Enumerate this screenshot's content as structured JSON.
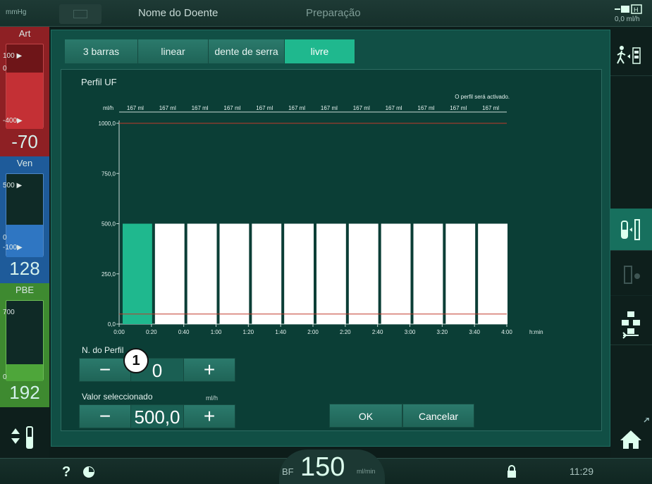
{
  "topbar": {
    "pressure_unit": "mmHg",
    "patient_name": "Nome do Doente",
    "phase": "Preparação",
    "uf_rate": "0,0  ml/h"
  },
  "pressures": {
    "art": {
      "label": "Art",
      "top_tick": "100 ▶",
      "zero_tick": "0",
      "bottom_tick": "-400▶",
      "value": "-70",
      "color": "#b52a2f"
    },
    "ven": {
      "label": "Ven",
      "top_tick": "500 ▶",
      "zero_tick": "0",
      "bottom_tick": "-100▶",
      "value": "128",
      "color": "#2a6bb0"
    },
    "pbe": {
      "label": "PBE",
      "top_tick": "700",
      "zero_tick": "0",
      "value": "192",
      "color": "#4ea63a"
    }
  },
  "tabs": [
    {
      "label": "3 barras",
      "active": false
    },
    {
      "label": "linear",
      "active": false
    },
    {
      "label": "dente de serra",
      "active": false
    },
    {
      "label": "livre",
      "active": true
    }
  ],
  "panel": {
    "title": "Perfil UF",
    "notice": "O perfil será activado.",
    "profile_label": "N. do Perfil",
    "profile_value": "0",
    "callout": "1",
    "selected_label": "Valor seleccionado",
    "selected_unit": "ml/h",
    "selected_value": "500,0",
    "ok_label": "OK",
    "cancel_label": "Cancelar",
    "minus": "−",
    "plus": "+"
  },
  "chart_data": {
    "type": "bar",
    "ylabel": "ml/h",
    "xlabel": "h:min",
    "ylim": [
      0,
      1000
    ],
    "yticks": [
      "0,0",
      "250,0",
      "500,0",
      "750,0",
      "1000,0"
    ],
    "ytick_values": [
      0,
      250,
      500,
      750,
      1000
    ],
    "xticks": [
      "0:00",
      "0:20",
      "0:40",
      "1:00",
      "1:20",
      "1:40",
      "2:00",
      "2:20",
      "2:40",
      "3:00",
      "3:20",
      "3:40",
      "4:00"
    ],
    "bar_volumes": [
      "167 ml",
      "167 ml",
      "167 ml",
      "167 ml",
      "167 ml",
      "167 ml",
      "167 ml",
      "167 ml",
      "167 ml",
      "167 ml",
      "167 ml",
      "167 ml"
    ],
    "values": [
      500,
      500,
      500,
      500,
      500,
      500,
      500,
      500,
      500,
      500,
      500,
      500
    ],
    "selected_index": 0,
    "upper_limit": 1000,
    "lower_limit": 50,
    "bar_color": "#ffffff",
    "selected_color": "#1fb88e",
    "limit_color": "#c0392b"
  },
  "bottombar": {
    "help": "?",
    "bf_label": "BF",
    "bf_value": "150",
    "bf_unit": "ml/min",
    "time": "11:29"
  }
}
